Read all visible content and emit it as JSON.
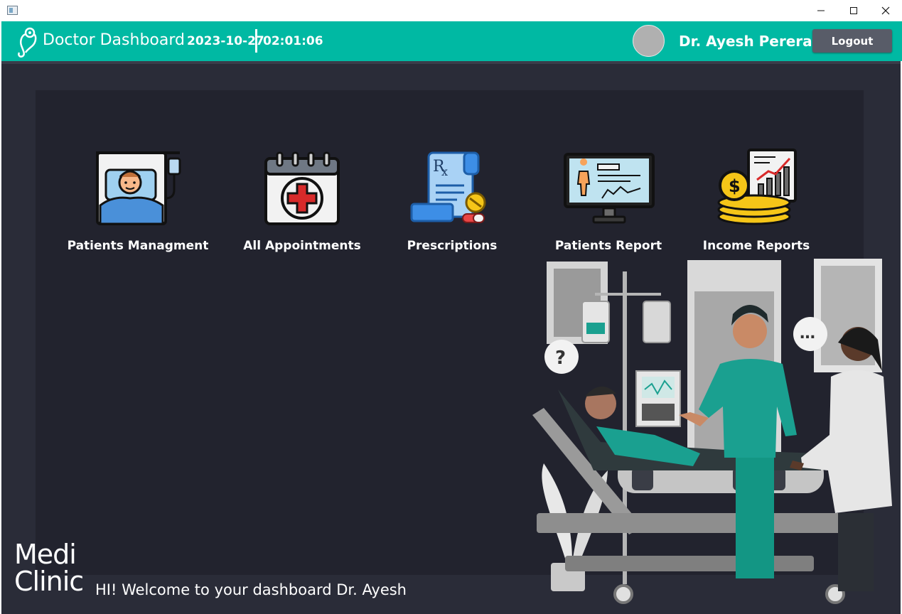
{
  "window": {
    "minimize_glyph": "—",
    "maximize_glyph": "☐",
    "close_glyph": "✕"
  },
  "header": {
    "title": "Doctor Dashboard",
    "date": "2023-10-27",
    "time": "02:01:06",
    "user_name": "Dr. Ayesh Perera",
    "logout_label": "Logout",
    "accent_color": "#00b9a3"
  },
  "menu": {
    "items": [
      {
        "label": "Patients Managment",
        "icon": "patient-bed-icon"
      },
      {
        "label": "All Appointments",
        "icon": "calendar-medical-icon"
      },
      {
        "label": "Prescriptions",
        "icon": "prescription-icon"
      },
      {
        "label": "Patients Report",
        "icon": "monitor-report-icon"
      },
      {
        "label": "Income Reports",
        "icon": "income-chart-icon"
      }
    ]
  },
  "footer": {
    "logo_line1": "Medi",
    "logo_line2": "Clinic",
    "welcome": "HI! Welcome to your dashboard Dr. Ayesh"
  }
}
